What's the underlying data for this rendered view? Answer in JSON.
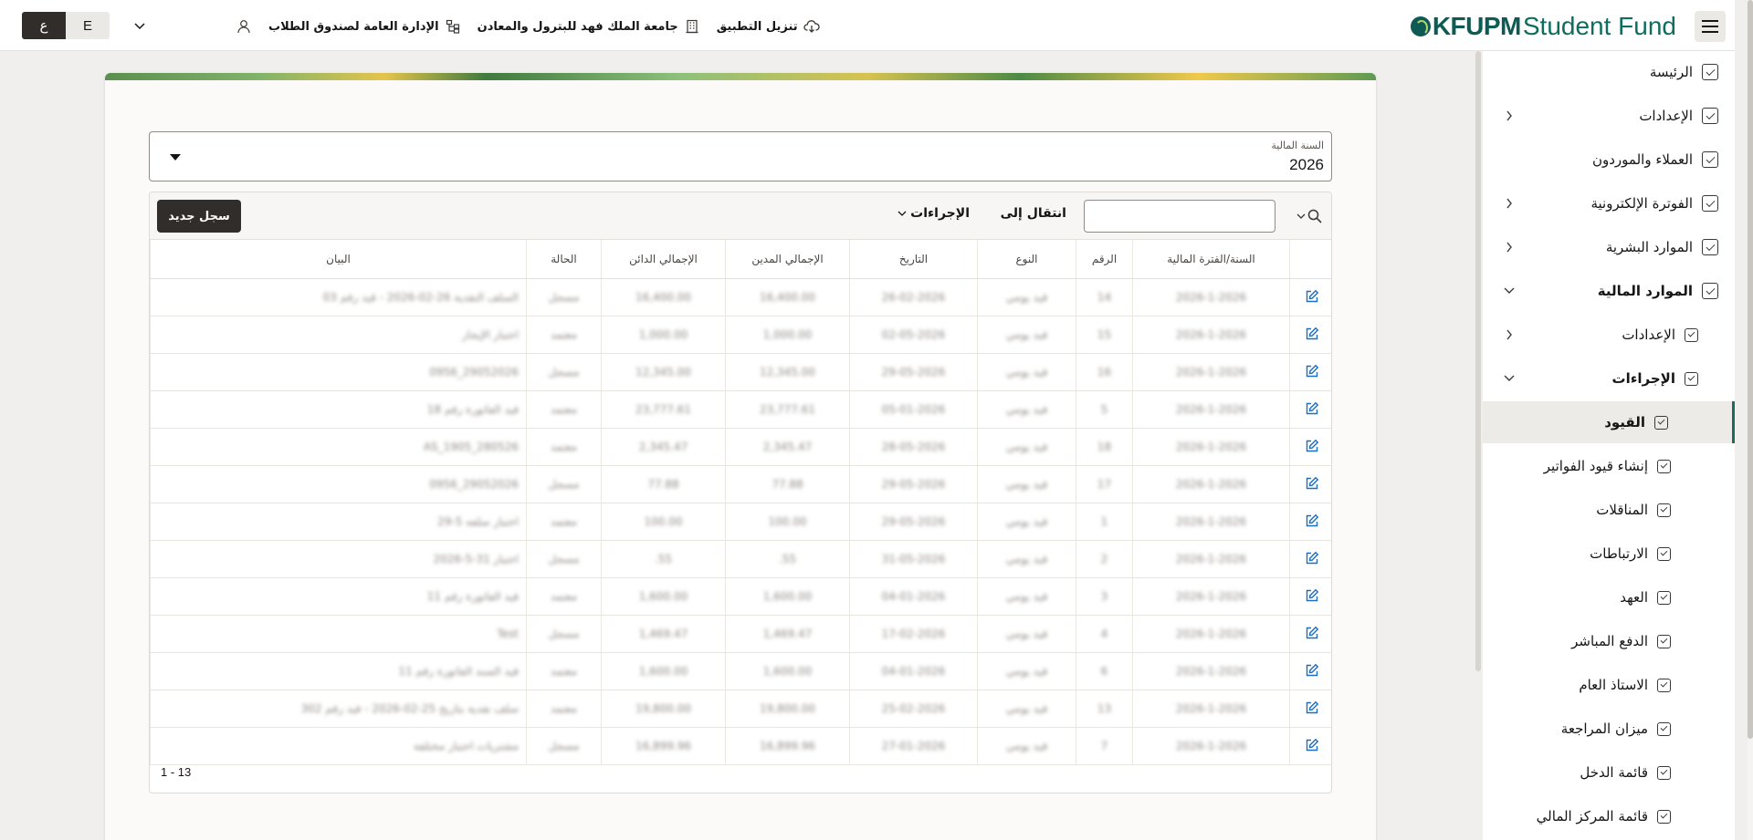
{
  "header": {
    "logo_primary": "KFUPM",
    "logo_secondary": "Student Fund",
    "links": [
      {
        "label": "تنزيل التطبيق",
        "icon": "cloud-download-icon"
      },
      {
        "label": "جامعة الملك فهد للبترول والمعادن",
        "icon": "building-icon"
      },
      {
        "label": "الإدارة العامة لصندوق الطلاب",
        "icon": "org-chart-icon"
      }
    ],
    "lang_ar": "ع",
    "lang_en": "E"
  },
  "sidebar": {
    "items": [
      {
        "label": "الرئيسة",
        "level": 0
      },
      {
        "label": "الإعدادات",
        "level": 0,
        "chevron": "right"
      },
      {
        "label": "العملاء والموردون",
        "level": 0
      },
      {
        "label": "الفوترة الإلكترونية",
        "level": 0,
        "chevron": "right"
      },
      {
        "label": "الموارد البشرية",
        "level": 0,
        "chevron": "right"
      },
      {
        "label": "الموارد المالية",
        "level": 0,
        "chevron": "down",
        "bold": true
      },
      {
        "label": "الإعدادات",
        "level": 1,
        "chevron": "right"
      },
      {
        "label": "الإجراءات",
        "level": 1,
        "chevron": "down",
        "bold": true
      },
      {
        "label": "القيود",
        "level": 2,
        "active": true,
        "bold": true
      },
      {
        "label": "إنشاء قيود الفواتير",
        "level": 2
      },
      {
        "label": "المناقلات",
        "level": 2
      },
      {
        "label": "الارتباطات",
        "level": 2
      },
      {
        "label": "العهد",
        "level": 2
      },
      {
        "label": "الدفع المباشر",
        "level": 2
      },
      {
        "label": "الاستاذ العام",
        "level": 2
      },
      {
        "label": "ميزان المراجعة",
        "level": 2
      },
      {
        "label": "قائمة الدخل",
        "level": 2
      },
      {
        "label": "قائمة المركز المالي",
        "level": 2
      }
    ]
  },
  "fiscal_year": {
    "label": "السنة المالية",
    "value": "2026"
  },
  "toolbar": {
    "goto_label": "انتقال إلى",
    "actions_label": "الإجراءات",
    "new_record_label": "سجل جديد",
    "search_value": ""
  },
  "grid": {
    "columns": [
      "السنة/الفترة المالية",
      "الرقم",
      "النوع",
      "التاريخ",
      "الإجمالي المدين",
      "الإجمالي الدائن",
      "الحالة",
      "البيان"
    ],
    "rows": [
      [
        "2026-1-2026",
        "14",
        "قيد يومي",
        "26-02-2026",
        "16,400.00",
        "16,400.00",
        "مسجل",
        "السلف النقدية 26-02-2026 - قيد رقم 03"
      ],
      [
        "2026-1-2026",
        "15",
        "قيد يومي",
        "02-05-2026",
        "1,000.00",
        "1,000.00",
        "معتمد",
        "اختبار الإيجار"
      ],
      [
        "2026-1-2026",
        "16",
        "قيد يومي",
        "29-05-2026",
        "12,345.00",
        "12,345.00",
        "مسجل",
        "29052026_0956"
      ],
      [
        "2026-1-2026",
        "5",
        "قيد يومي",
        "05-01-2026",
        "23,777.61",
        "23,777.61",
        "معتمد",
        "قيد الفاتورة رقم 18"
      ],
      [
        "2026-1-2026",
        "18",
        "قيد يومي",
        "28-05-2026",
        "2,345.47",
        "2,345.47",
        "معتمد",
        "AS_1905_280526"
      ],
      [
        "2026-1-2026",
        "17",
        "قيد يومي",
        "29-05-2026",
        "77.88",
        "77.88",
        "مسجل",
        "29052026_0956"
      ],
      [
        "2026-1-2026",
        "1",
        "قيد يومي",
        "29-05-2026",
        "100.00",
        "100.00",
        "معتمد",
        "اختبار سلفه 5-29"
      ],
      [
        "2026-1-2026",
        "2",
        "قيد يومي",
        "31-05-2026",
        "55.",
        "55.",
        "مسجل",
        "اختبار 31-5-2026"
      ],
      [
        "2026-1-2026",
        "3",
        "قيد يومي",
        "04-01-2026",
        "1,600.00",
        "1,600.00",
        "معتمد",
        "قيد الفاتورة رقم 11"
      ],
      [
        "2026-1-2026",
        "4",
        "قيد يومي",
        "17-02-2026",
        "1,469.47",
        "1,469.47",
        "مسجل",
        "Test"
      ],
      [
        "2026-1-2026",
        "6",
        "قيد يومي",
        "04-01-2026",
        "1,600.00",
        "1,600.00",
        "معتمد",
        "قيد السند الفاتورة رقم 11"
      ],
      [
        "2026-1-2026",
        "13",
        "قيد يومي",
        "25-02-2026",
        "19,800.00",
        "19,800.00",
        "معتمد",
        "سلف نقدية بتاريخ 25-02-2026 - قيد رقم 302"
      ],
      [
        "2026-1-2026",
        "7",
        "قيد يومي",
        "27-01-2026",
        "16,899.96",
        "16,899.96",
        "مسجل",
        "مشتريات اختبار مختلفة"
      ]
    ]
  },
  "pager": "1 - 13",
  "colors": {
    "brand": "#0e5a54",
    "dark_button": "#312d2a",
    "active_border": "#1d6a60",
    "edit_icon": "#1b6ec2"
  }
}
